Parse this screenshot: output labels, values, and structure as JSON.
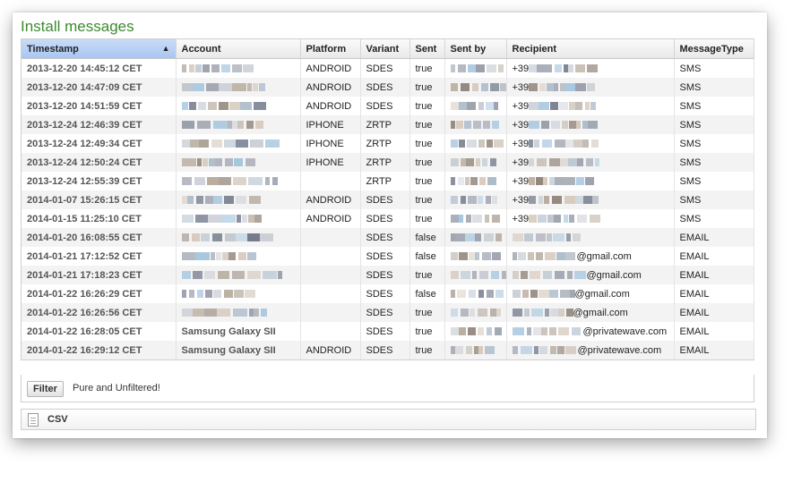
{
  "title": "Install messages",
  "columns": [
    "Timestamp",
    "Account",
    "Platform",
    "Variant",
    "Sent",
    "Sent by",
    "Recipient",
    "MessageType"
  ],
  "sort_arrow": "▲",
  "rows": [
    {
      "ts": "2013-12-20 14:45:12 CET",
      "account": "",
      "platform": "ANDROID",
      "variant": "SDES",
      "sent": "true",
      "recipient": "+39",
      "type": "SMS"
    },
    {
      "ts": "2013-12-20 14:47:09 CET",
      "account": "",
      "platform": "ANDROID",
      "variant": "SDES",
      "sent": "true",
      "recipient": "+39",
      "type": "SMS"
    },
    {
      "ts": "2013-12-20 14:51:59 CET",
      "account": "",
      "platform": "ANDROID",
      "variant": "SDES",
      "sent": "true",
      "recipient": "+39",
      "type": "SMS"
    },
    {
      "ts": "2013-12-24 12:46:39 CET",
      "account": "",
      "platform": "IPHONE",
      "variant": "ZRTP",
      "sent": "true",
      "recipient": "+39",
      "type": "SMS"
    },
    {
      "ts": "2013-12-24 12:49:34 CET",
      "account": "",
      "platform": "IPHONE",
      "variant": "ZRTP",
      "sent": "true",
      "recipient": "+39",
      "type": "SMS"
    },
    {
      "ts": "2013-12-24 12:50:24 CET",
      "account": "",
      "platform": "IPHONE",
      "variant": "ZRTP",
      "sent": "true",
      "recipient": "+39",
      "type": "SMS"
    },
    {
      "ts": "2013-12-24 12:55:39 CET",
      "account": "",
      "platform": "",
      "variant": "ZRTP",
      "sent": "true",
      "recipient": "+39",
      "type": "SMS"
    },
    {
      "ts": "2014-01-07 15:26:15 CET",
      "account": "",
      "platform": "ANDROID",
      "variant": "SDES",
      "sent": "true",
      "recipient": "+39",
      "type": "SMS"
    },
    {
      "ts": "2014-01-15 11:25:10 CET",
      "account": "",
      "platform": "ANDROID",
      "variant": "SDES",
      "sent": "true",
      "recipient": "+39",
      "type": "SMS"
    },
    {
      "ts": "2014-01-20 16:08:55 CET",
      "account": "",
      "platform": "",
      "variant": "SDES",
      "sent": "false",
      "recipient": "",
      "type": "EMAIL"
    },
    {
      "ts": "2014-01-21 17:12:52 CET",
      "account": "",
      "platform": "",
      "variant": "SDES",
      "sent": "false",
      "recipient": "@gmail.com",
      "type": "EMAIL"
    },
    {
      "ts": "2014-01-21 17:18:23 CET",
      "account": "",
      "platform": "",
      "variant": "SDES",
      "sent": "true",
      "recipient": "@gmail.com",
      "type": "EMAIL"
    },
    {
      "ts": "2014-01-22 16:26:29 CET",
      "account": "",
      "platform": "",
      "variant": "SDES",
      "sent": "false",
      "recipient": "@gmail.com",
      "type": "EMAIL"
    },
    {
      "ts": "2014-01-22 16:26:56 CET",
      "account": "",
      "platform": "",
      "variant": "SDES",
      "sent": "true",
      "recipient": "@gmail.com",
      "type": "EMAIL"
    },
    {
      "ts": "2014-01-22 16:28:05 CET",
      "account": "Samsung Galaxy SII",
      "platform": "",
      "variant": "SDES",
      "sent": "true",
      "recipient": "@privatewave.com",
      "type": "EMAIL"
    },
    {
      "ts": "2014-01-22 16:29:12 CET",
      "account": "Samsung Galaxy SII",
      "platform": "ANDROID",
      "variant": "SDES",
      "sent": "true",
      "recipient": "@privatewave.com",
      "type": "EMAIL"
    }
  ],
  "filter": {
    "button": "Filter",
    "text": "Pure and Unfiltered!"
  },
  "csv": {
    "label": "CSV"
  },
  "icons": {
    "csv": "document-icon",
    "sort": "sort-ascending-icon"
  }
}
